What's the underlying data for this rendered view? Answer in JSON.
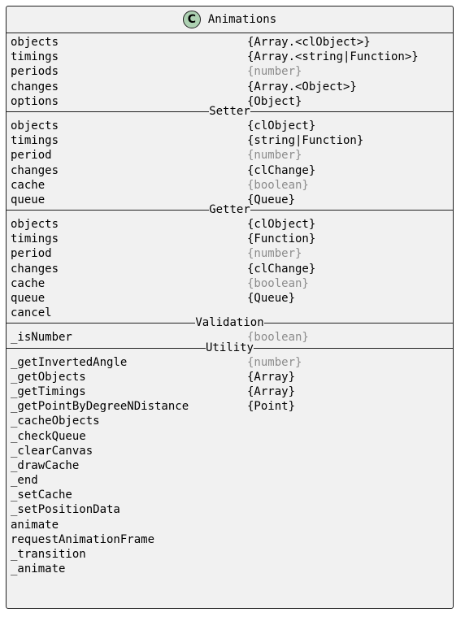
{
  "title": "Animations",
  "badge": "C",
  "attributes": [
    {
      "name": "objects",
      "type": "{Array.<clObject>}",
      "muted": false
    },
    {
      "name": "timings",
      "type": "{Array.<string|Function>}",
      "muted": false
    },
    {
      "name": "periods",
      "type": "{number}",
      "muted": true
    },
    {
      "name": "changes",
      "type": "{Array.<Object>}",
      "muted": false
    },
    {
      "name": "options",
      "type": "{Object}",
      "muted": false
    }
  ],
  "sections": [
    {
      "label": "Setter",
      "rows": [
        {
          "name": "objects",
          "type": "{clObject}",
          "muted": false
        },
        {
          "name": "timings",
          "type": "{string|Function}",
          "muted": false
        },
        {
          "name": "period",
          "type": "{number}",
          "muted": true
        },
        {
          "name": "changes",
          "type": "{clChange}",
          "muted": false
        },
        {
          "name": "cache",
          "type": "{boolean}",
          "muted": true
        },
        {
          "name": "queue",
          "type": "{Queue}",
          "muted": false
        }
      ]
    },
    {
      "label": "Getter",
      "rows": [
        {
          "name": "objects",
          "type": "{clObject}",
          "muted": false
        },
        {
          "name": "timings",
          "type": "{Function}",
          "muted": false
        },
        {
          "name": "period",
          "type": "{number}",
          "muted": true
        },
        {
          "name": "changes",
          "type": "{clChange}",
          "muted": false
        },
        {
          "name": "cache",
          "type": "{boolean}",
          "muted": true
        },
        {
          "name": "queue",
          "type": "{Queue}",
          "muted": false
        },
        {
          "name": "cancel",
          "type": "",
          "muted": false
        }
      ]
    },
    {
      "label": "Validation",
      "rows": [
        {
          "name": "_isNumber",
          "type": "{boolean}",
          "muted": true
        }
      ]
    },
    {
      "label": "Utility",
      "rows": [
        {
          "name": "_getInvertedAngle",
          "type": "{number}",
          "muted": true
        },
        {
          "name": "_getObjects",
          "type": "{Array}",
          "muted": false
        },
        {
          "name": "_getTimings",
          "type": "{Array}",
          "muted": false
        },
        {
          "name": "_getPointByDegreeNDistance",
          "type": "{Point}",
          "muted": false
        },
        {
          "name": "_cacheObjects",
          "type": "",
          "muted": false
        },
        {
          "name": "_checkQueue",
          "type": "",
          "muted": false
        },
        {
          "name": "_clearCanvas",
          "type": "",
          "muted": false
        },
        {
          "name": "_drawCache",
          "type": "",
          "muted": false
        },
        {
          "name": "_end",
          "type": "",
          "muted": false
        },
        {
          "name": "_setCache",
          "type": "",
          "muted": false
        },
        {
          "name": "_setPositionData",
          "type": "",
          "muted": false
        },
        {
          "name": "animate",
          "type": "",
          "muted": false
        },
        {
          "name": "requestAnimationFrame",
          "type": "",
          "muted": false
        },
        {
          "name": "_transition",
          "type": "",
          "muted": false
        },
        {
          "name": "_animate",
          "type": "",
          "muted": false
        }
      ]
    }
  ]
}
